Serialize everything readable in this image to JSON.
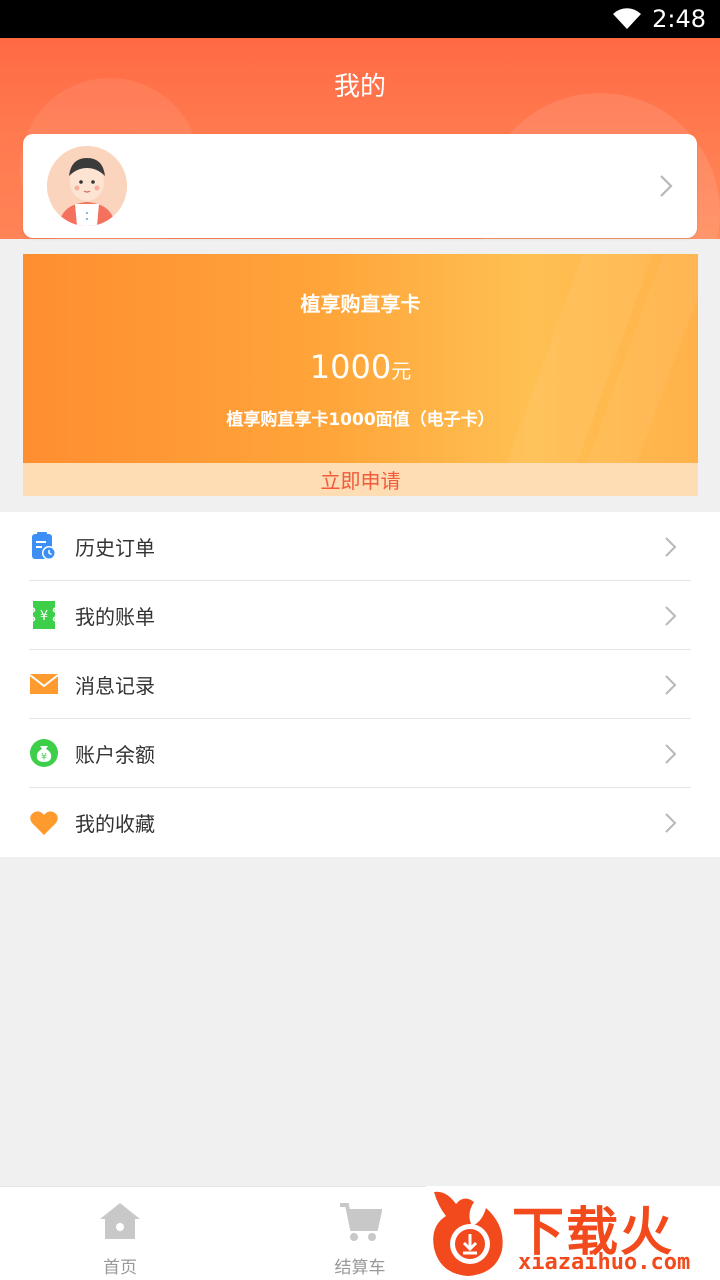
{
  "status_bar": {
    "time": "2:48"
  },
  "header": {
    "title": "我的"
  },
  "promo": {
    "title": "植享购直享卡",
    "amount": "1000",
    "unit": "元",
    "description": "植享购直享卡1000面值（电子卡）",
    "apply_label": "立即申请"
  },
  "menu": {
    "items": [
      {
        "label": "历史订单",
        "icon": "order-history-icon",
        "color": "#3d8ef5"
      },
      {
        "label": "我的账单",
        "icon": "bill-icon",
        "color": "#3ecf4a"
      },
      {
        "label": "消息记录",
        "icon": "mail-icon",
        "color": "#ff9a2e"
      },
      {
        "label": "账户余额",
        "icon": "money-bag-icon",
        "color": "#3ecf4a"
      },
      {
        "label": "我的收藏",
        "icon": "heart-icon",
        "color": "#ff9a2e"
      }
    ]
  },
  "bottom_nav": {
    "home_label": "首页",
    "cart_label": "结算车"
  },
  "watermark": {
    "brand": "下载火",
    "url": "xiazaihuo.com"
  },
  "colors": {
    "header": "#ff6a44",
    "promo_start": "#ff8e30",
    "promo_end": "#ffc052",
    "apply_text": "#f25a3a"
  }
}
